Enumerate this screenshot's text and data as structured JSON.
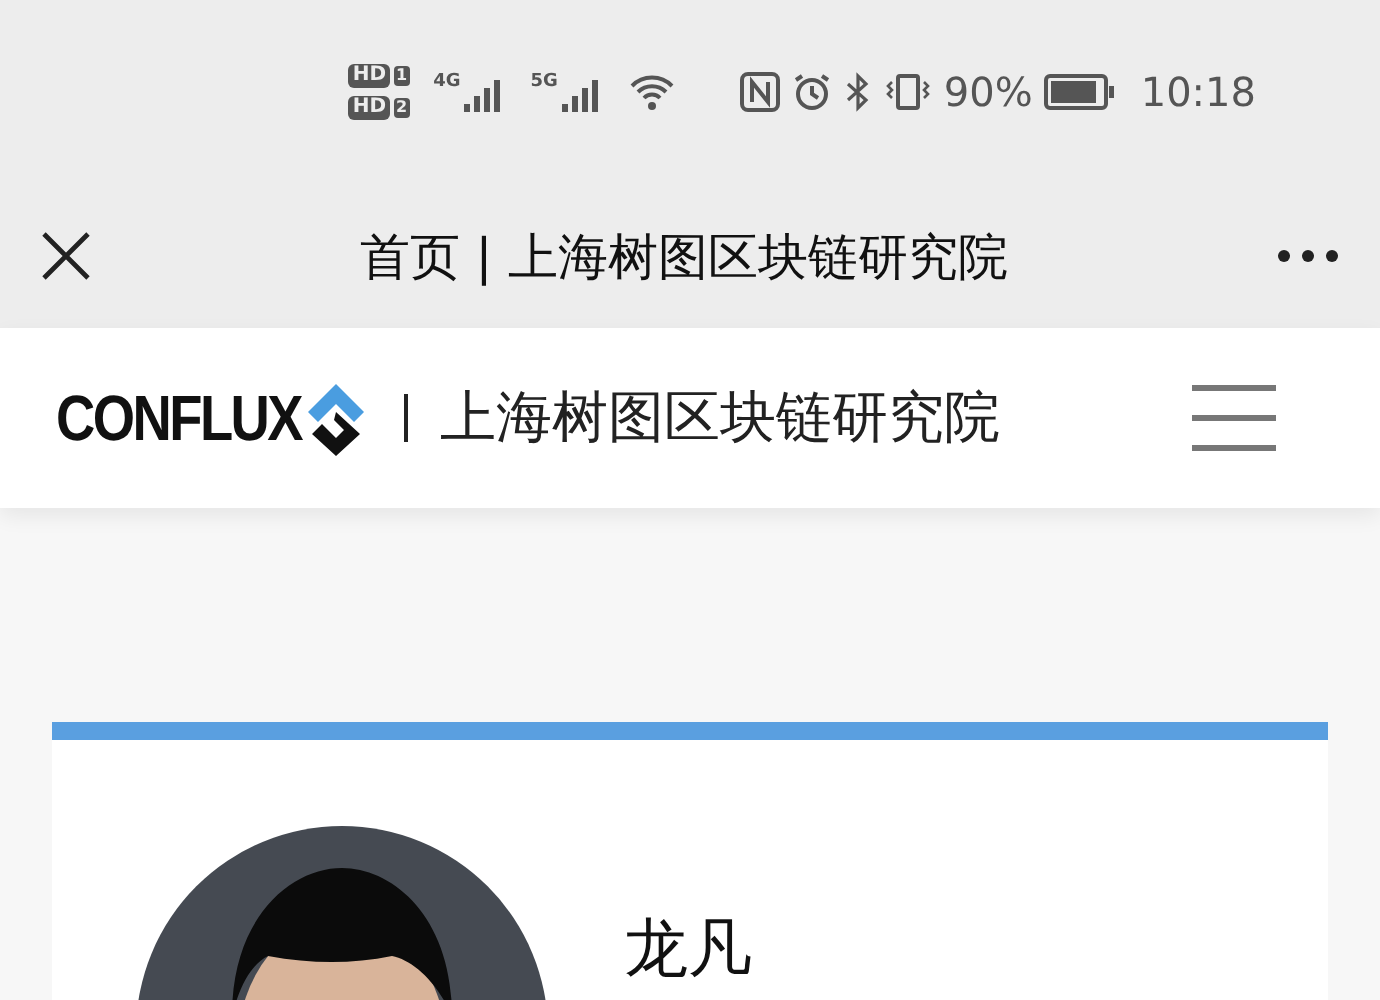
{
  "status_bar": {
    "sim_badges": [
      {
        "label": "HD",
        "slot": "1"
      },
      {
        "label": "HD",
        "slot": "2"
      }
    ],
    "networks": [
      "4G",
      "5G"
    ],
    "battery_text": "90%",
    "battery": {
      "level": 0.9
    },
    "time": "10:18"
  },
  "title_bar": {
    "title": "首页 | 上海树图区块链研究院"
  },
  "header": {
    "logo": "CONFLUX",
    "org": "上海树图区块链研究院"
  },
  "profile": {
    "name": "龙凡"
  }
}
